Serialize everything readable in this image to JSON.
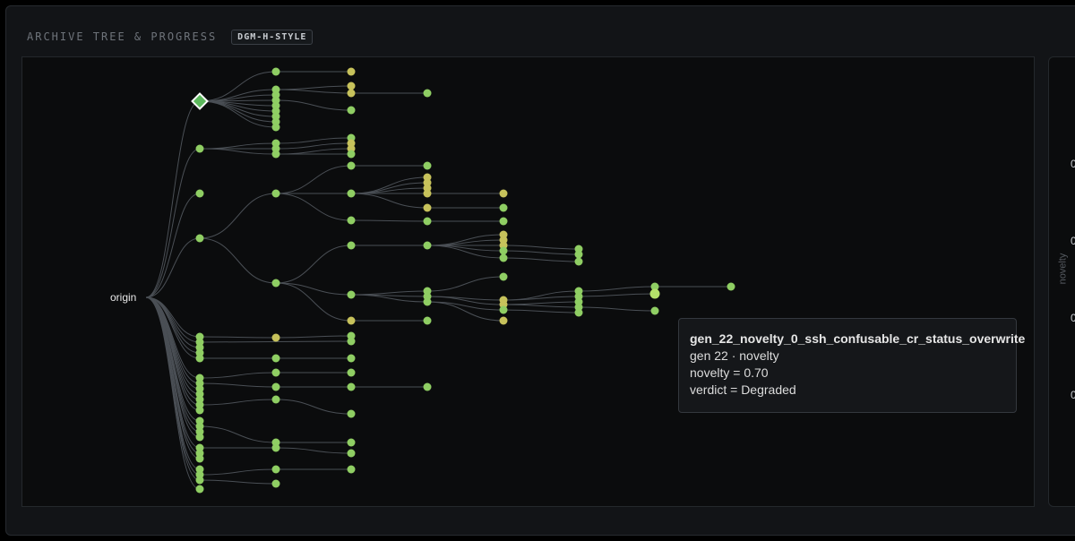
{
  "header": {
    "title": "ARCHIVE TREE & PROGRESS",
    "badge": "DGM-H-STYLE"
  },
  "tree": {
    "root_label": "origin",
    "colors": {
      "green": "#8fce63",
      "lightgreen": "#b4e06a",
      "olive": "#c7c25b",
      "edge": "#4a4f55",
      "diamond_fill": "#5cb85c"
    }
  },
  "side_chart": {
    "ylabel": "novelty",
    "tick_labels": [
      "0",
      "0",
      "0",
      "0"
    ]
  },
  "tooltip": {
    "title": "gen_22_novelty_0_ssh_confusable_cr_status_overwrite",
    "line1": "gen 22 · novelty",
    "line2": "novelty = 0.70",
    "line3": "verdict = Degraded"
  }
}
